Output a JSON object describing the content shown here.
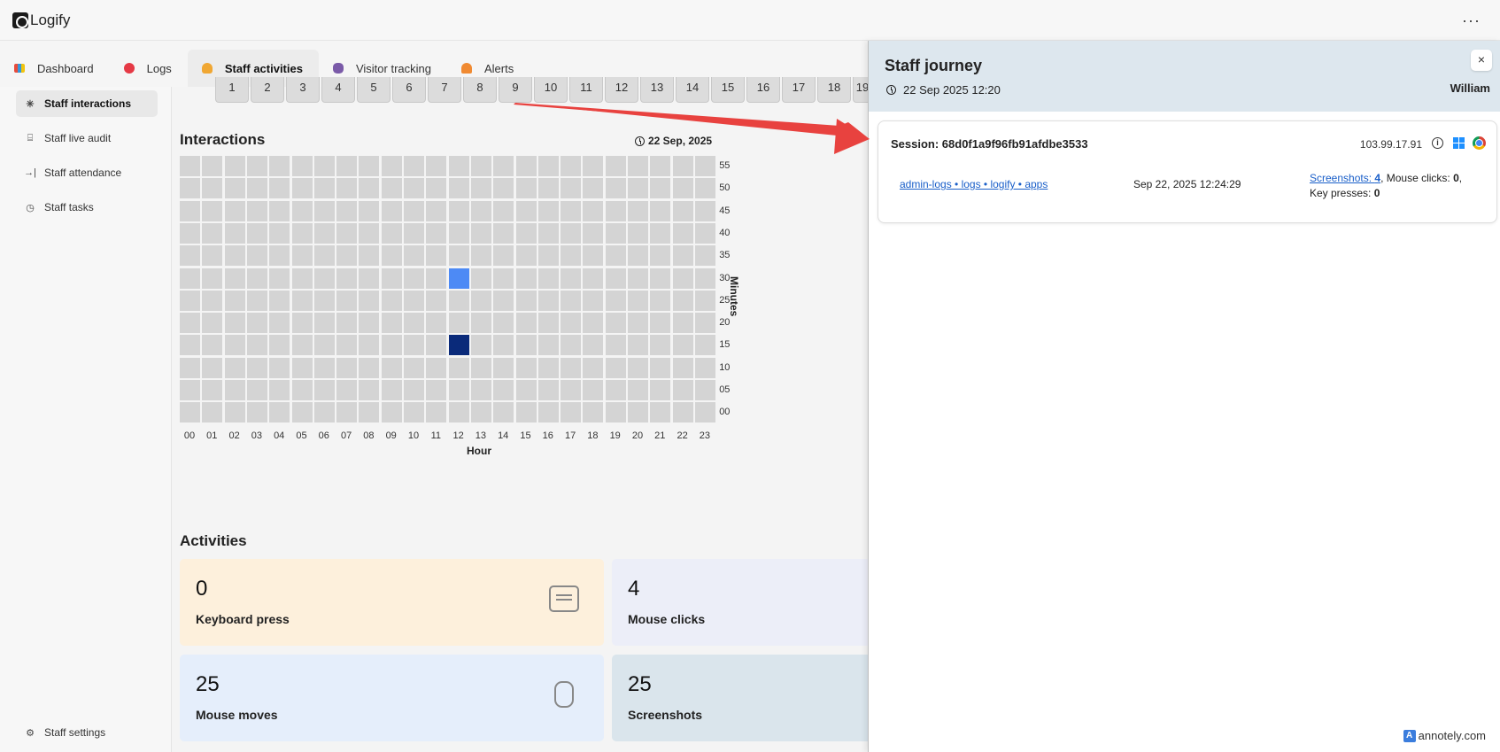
{
  "app": {
    "title": "Logify",
    "more": "···"
  },
  "tabs": [
    {
      "label": "Dashboard",
      "icon": "chart-icon"
    },
    {
      "label": "Logs",
      "icon": "logs-icon"
    },
    {
      "label": "Staff activities",
      "icon": "staff-icon",
      "active": true
    },
    {
      "label": "Visitor tracking",
      "icon": "footprints-icon"
    },
    {
      "label": "Alerts",
      "icon": "bell-icon"
    }
  ],
  "sidebar": {
    "items": [
      {
        "label": "Staff interactions",
        "icon": "sparkle-icon",
        "active": true
      },
      {
        "label": "Staff live audit",
        "icon": "audit-icon"
      },
      {
        "label": "Staff attendance",
        "icon": "login-icon"
      },
      {
        "label": "Staff tasks",
        "icon": "clock-icon"
      }
    ],
    "settings": {
      "label": "Staff settings",
      "icon": "gear-icon"
    }
  },
  "pages": [
    "1",
    "2",
    "3",
    "4",
    "5",
    "6",
    "7",
    "8",
    "9",
    "10",
    "11",
    "12",
    "13",
    "14",
    "15",
    "16",
    "17",
    "18",
    "19"
  ],
  "interactions": {
    "title": "Interactions",
    "date": "22 Sep, 2025"
  },
  "chart_data": {
    "type": "heatmap",
    "title": "Interactions",
    "xlabel": "Hour",
    "ylabel": "Minutes",
    "x": [
      "00",
      "01",
      "02",
      "03",
      "04",
      "05",
      "06",
      "07",
      "08",
      "09",
      "10",
      "11",
      "12",
      "13",
      "14",
      "15",
      "16",
      "17",
      "18",
      "19",
      "20",
      "21",
      "22",
      "23"
    ],
    "y": [
      "55",
      "50",
      "45",
      "40",
      "35",
      "30",
      "25",
      "20",
      "15",
      "10",
      "05",
      "00"
    ],
    "cells": [
      {
        "x": "12",
        "y": "30",
        "level": "medium",
        "color": "#4d8af5"
      },
      {
        "x": "12",
        "y": "15",
        "level": "high",
        "color": "#0a2a7a"
      }
    ],
    "empty_color": "#d4d4d4"
  },
  "activities": {
    "title": "Activities",
    "cards": [
      {
        "value": "0",
        "label": "Keyboard press",
        "icon": "keyboard-icon",
        "color": "#fdf0dc"
      },
      {
        "value": "4",
        "label": "Mouse clicks",
        "icon": "",
        "color": "#eceef8"
      },
      {
        "value": "25",
        "label": "Mouse moves",
        "icon": "mouse-move-icon",
        "color": "#e5eefb"
      },
      {
        "value": "25",
        "label": "Screenshots",
        "icon": "",
        "color": "#dae5ec"
      }
    ]
  },
  "drawer": {
    "title": "Staff journey",
    "date": "22 Sep 2025 12:20",
    "user": "William",
    "close": "×",
    "session": {
      "title": "Session: 68d0f1a9f96fb91afdbe3533",
      "ip": "103.99.17.91",
      "link": "admin-logs • logs • logify • apps",
      "time": "Sep 22, 2025 12:24:29",
      "screenshots_label": "Screenshots:",
      "screenshots_value": "4",
      "mouse_clicks_label": ", Mouse clicks:",
      "mouse_clicks_value": "0",
      "key_presses_label": "Key presses:",
      "key_presses_value": "0"
    }
  },
  "watermark": {
    "mark": "A",
    "text": "annotely.com"
  }
}
